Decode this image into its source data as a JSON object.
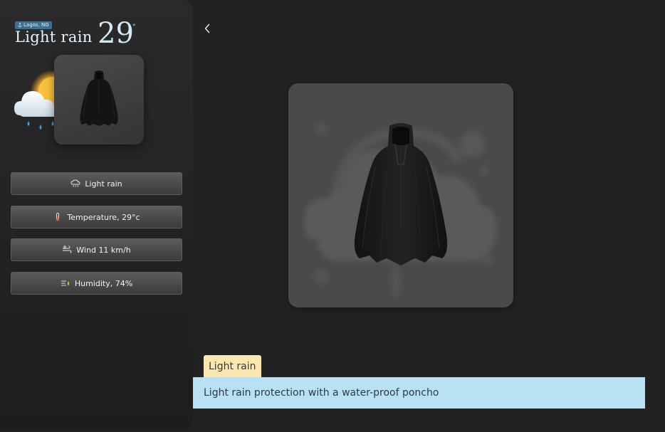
{
  "sidebar": {
    "location": "Lagos, NG",
    "condition": "Light rain",
    "temperature": "29",
    "degree_symbol": "°",
    "weather_icon": "sun-behind-rain-cloud-icon",
    "items": [
      {
        "icon": "cloud-rain-icon",
        "label": "Light rain"
      },
      {
        "icon": "thermometer-icon",
        "label": "Temperature, 29°c"
      },
      {
        "icon": "wind-icon",
        "label": "Wind 11 km/h"
      },
      {
        "icon": "humidity-icon",
        "label": "Humidity, 74%"
      }
    ]
  },
  "main": {
    "back_icon": "chevron-left-icon",
    "tag": "Light rain",
    "caption": "Light rain protection with a water-proof poncho"
  },
  "colors": {
    "background": "#222222",
    "location_badge": "#3d6f8e",
    "tag_chip": "#fde7b0",
    "caption_bar": "#b8e1f4"
  }
}
